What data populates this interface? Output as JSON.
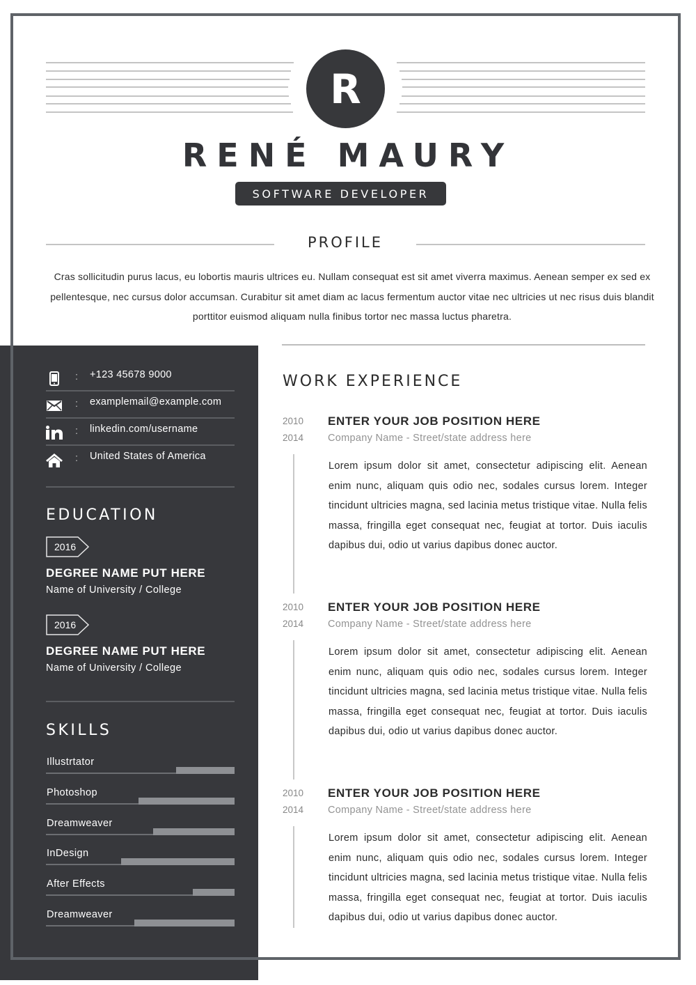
{
  "header": {
    "monogram": "R",
    "name": "RENÉ MAURY",
    "title": "SOFTWARE DEVELOPER"
  },
  "profile": {
    "heading": "PROFILE",
    "text": "Cras sollicitudin purus lacus, eu lobortis mauris ultrices eu. Nullam consequat est sit amet viverra maximus. Aenean semper ex sed ex pellentesque, nec cursus dolor accumsan. Curabitur sit amet diam ac lacus fermentum auctor vitae nec ultricies ut nec risus duis blandit porttitor euismod aliquam nulla finibus tortor nec massa luctus pharetra."
  },
  "contact": [
    {
      "icon": "phone-icon",
      "separator": ":",
      "value": "+123 45678 9000"
    },
    {
      "icon": "mail-icon",
      "separator": ":",
      "value": "examplemail@example.com"
    },
    {
      "icon": "linkedin-icon",
      "separator": ":",
      "value": "linkedin.com/username"
    },
    {
      "icon": "home-icon",
      "separator": ":",
      "value": "United States of America"
    }
  ],
  "education": {
    "heading": "EDUCATION",
    "items": [
      {
        "year": "2016",
        "degree": "DEGREE NAME PUT HERE",
        "school": "Name of University / College"
      },
      {
        "year": "2016",
        "degree": "DEGREE NAME PUT HERE",
        "school": "Name of University / College"
      }
    ]
  },
  "skills": {
    "heading": "SKILLS",
    "items": [
      {
        "name": "Illustrtator",
        "level": 0.31
      },
      {
        "name": "Photoshop",
        "level": 0.51
      },
      {
        "name": "Dreamweaver",
        "level": 0.43
      },
      {
        "name": "InDesign",
        "level": 0.6
      },
      {
        "name": "After Effects",
        "level": 0.22
      },
      {
        "name": "Dreamweaver",
        "level": 0.53
      }
    ]
  },
  "work": {
    "heading": "WORK EXPERIENCE",
    "jobs": [
      {
        "start": "2010",
        "end": "2014",
        "position": "ENTER YOUR JOB POSITION HERE",
        "company": "Company Name - Street/state address here",
        "description": "Lorem ipsum dolor sit amet, consectetur adipiscing elit. Aenean enim nunc, aliquam quis odio nec, sodales cursus lorem. Integer tincidunt ultricies magna, sed lacinia metus tristique vitae. Nulla felis massa, fringilla eget consequat nec, feugiat at tortor. Duis iaculis dapibus dui, odio ut varius dapibus donec auctor."
      },
      {
        "start": "2010",
        "end": "2014",
        "position": "ENTER YOUR JOB POSITION HERE",
        "company": "Company Name - Street/state address here",
        "description": "Lorem ipsum dolor sit amet, consectetur adipiscing elit. Aenean enim nunc, aliquam quis odio nec, sodales cursus lorem. Integer tincidunt ultricies magna, sed lacinia metus tristique vitae. Nulla felis massa, fringilla eget consequat nec, feugiat at tortor. Duis iaculis dapibus dui, odio ut varius dapibus donec auctor."
      },
      {
        "start": "2010",
        "end": "2014",
        "position": "ENTER YOUR JOB POSITION HERE",
        "company": "Company Name - Street/state address here",
        "description": "Lorem ipsum dolor sit amet, consectetur adipiscing elit. Aenean enim nunc, aliquam quis odio nec, sodales cursus lorem. Integer tincidunt ultricies magna, sed lacinia metus tristique vitae. Nulla felis massa, fringilla eget consequat nec, feugiat at tortor. Duis iaculis dapibus dui, odio ut varius dapibus donec auctor."
      }
    ]
  },
  "colors": {
    "dark": "#37383c",
    "frame": "#5f6368",
    "rule": "#c4c4c4",
    "skill_fill": "#8e9094"
  }
}
